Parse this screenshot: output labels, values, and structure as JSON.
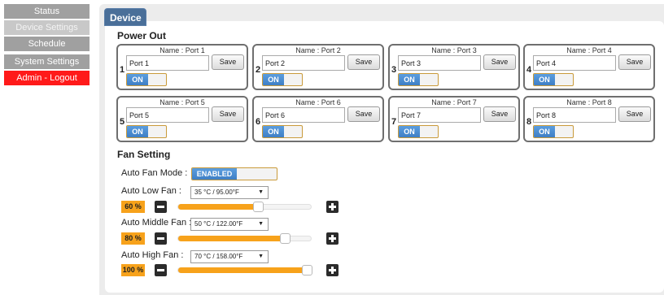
{
  "sidebar": {
    "items": [
      {
        "label": "Status"
      },
      {
        "label": "Device Settings"
      },
      {
        "label": "Schedule"
      },
      {
        "label": "System Settings"
      },
      {
        "label": "Admin - Logout"
      }
    ]
  },
  "tab": {
    "label": "Device"
  },
  "power_out": {
    "title": "Power Out",
    "save_label": "Save",
    "ports": [
      {
        "name_label": "Name : Port 1",
        "number": "1",
        "value": "Port 1",
        "state": "ON"
      },
      {
        "name_label": "Name : Port 2",
        "number": "2",
        "value": "Port 2",
        "state": "ON"
      },
      {
        "name_label": "Name : Port 3",
        "number": "3",
        "value": "Port 3",
        "state": "ON"
      },
      {
        "name_label": "Name : Port 4",
        "number": "4",
        "value": "Port 4",
        "state": "ON"
      },
      {
        "name_label": "Name : Port 5",
        "number": "5",
        "value": "Port 5",
        "state": "ON"
      },
      {
        "name_label": "Name : Port 6",
        "number": "6",
        "value": "Port 6",
        "state": "ON"
      },
      {
        "name_label": "Name : Port 7",
        "number": "7",
        "value": "Port 7",
        "state": "ON"
      },
      {
        "name_label": "Name : Port 8",
        "number": "8",
        "value": "Port 8",
        "state": "ON"
      }
    ]
  },
  "fan": {
    "title": "Fan Setting",
    "auto_mode_label": "Auto Fan Mode :",
    "auto_mode_state": "ENABLED",
    "rows": [
      {
        "label": "Auto Low Fan :",
        "temp": "35 °C / 95.00°F",
        "percent_label": "60 %",
        "percent": 60
      },
      {
        "label": "Auto Middle Fan :",
        "temp": "50 °C / 122.00°F",
        "percent_label": "80 %",
        "percent": 80
      },
      {
        "label": "Auto High Fan :",
        "temp": "70 °C / 158.00°F",
        "percent_label": "100 %",
        "percent": 100
      }
    ]
  },
  "colors": {
    "accent": "#f7a21b",
    "toggle_blue": "#4a8ed4",
    "logout_red": "#ff1a1a",
    "tab_blue": "#4a6f99"
  }
}
